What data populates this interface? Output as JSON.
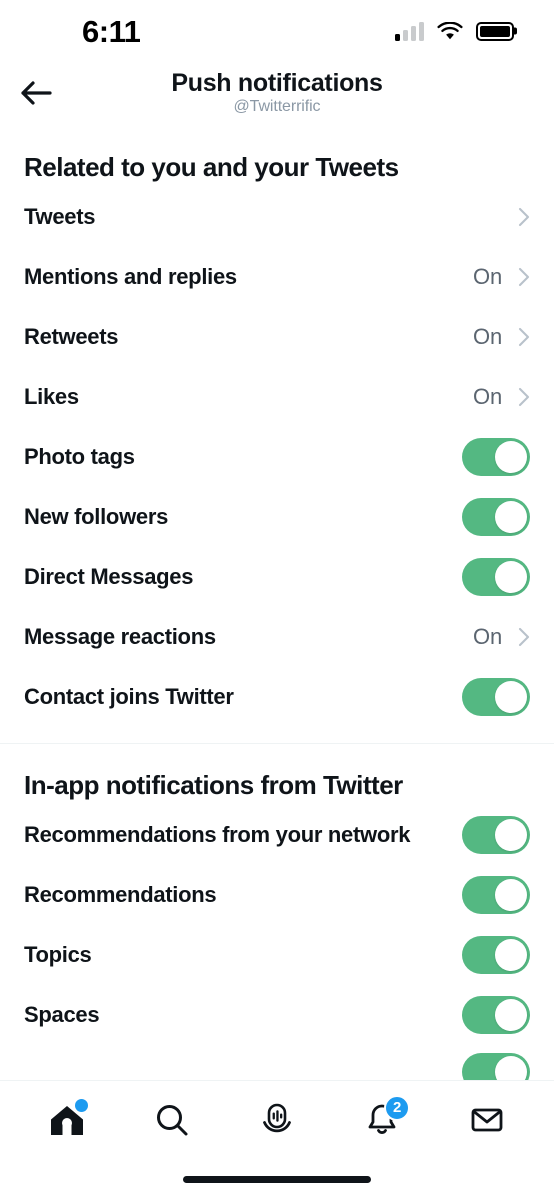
{
  "status_bar": {
    "time": "6:11",
    "signal_icon": "cellular-signal-icon",
    "signal_bars_active": 1,
    "wifi_icon": "wifi-icon",
    "battery_icon": "battery-icon",
    "battery_level_pct": 100
  },
  "header": {
    "back_icon": "back-arrow-icon",
    "title": "Push notifications",
    "subtitle": "@Twitterrific"
  },
  "sections": [
    {
      "title": "Related to you and your Tweets",
      "rows": [
        {
          "label": "Tweets",
          "type": "link",
          "value": "",
          "chevron_icon": "chevron-right-icon"
        },
        {
          "label": "Mentions and replies",
          "type": "link",
          "value": "On",
          "chevron_icon": "chevron-right-icon"
        },
        {
          "label": "Retweets",
          "type": "link",
          "value": "On",
          "chevron_icon": "chevron-right-icon"
        },
        {
          "label": "Likes",
          "type": "link",
          "value": "On",
          "chevron_icon": "chevron-right-icon"
        },
        {
          "label": "Photo tags",
          "type": "toggle",
          "state": "on"
        },
        {
          "label": "New followers",
          "type": "toggle",
          "state": "on"
        },
        {
          "label": "Direct Messages",
          "type": "toggle",
          "state": "on"
        },
        {
          "label": "Message reactions",
          "type": "link",
          "value": "On",
          "chevron_icon": "chevron-right-icon"
        },
        {
          "label": "Contact joins Twitter",
          "type": "toggle",
          "state": "on"
        }
      ]
    },
    {
      "title": "In-app notifications from Twitter",
      "rows": [
        {
          "label": "Recommendations from your network",
          "type": "toggle",
          "state": "on"
        },
        {
          "label": "Recommendations",
          "type": "toggle",
          "state": "on"
        },
        {
          "label": "Topics",
          "type": "toggle",
          "state": "on"
        },
        {
          "label": "Spaces",
          "type": "toggle",
          "state": "on"
        }
      ]
    }
  ],
  "tab_bar": {
    "tabs": [
      {
        "name": "home",
        "icon": "home-icon",
        "badge_dot": true,
        "badge_count": ""
      },
      {
        "name": "search",
        "icon": "search-icon",
        "badge_dot": false,
        "badge_count": ""
      },
      {
        "name": "spaces",
        "icon": "spaces-icon",
        "badge_dot": false,
        "badge_count": ""
      },
      {
        "name": "notifications",
        "icon": "bell-icon",
        "badge_dot": false,
        "badge_count": "2"
      },
      {
        "name": "messages",
        "icon": "envelope-icon",
        "badge_dot": false,
        "badge_count": ""
      }
    ]
  },
  "colors": {
    "toggle_on": "#54b882",
    "accent_blue": "#1d9bf0",
    "text_primary": "#0f1419",
    "text_secondary": "#5b6570",
    "text_muted": "#8b98a5",
    "divider": "#eff3f4"
  }
}
